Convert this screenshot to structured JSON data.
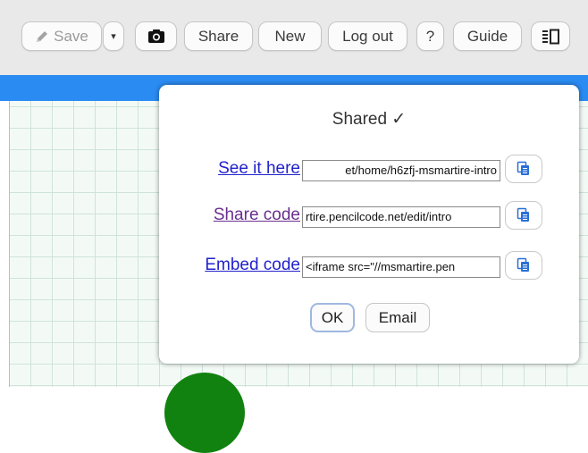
{
  "toolbar": {
    "save_label": "Save",
    "dropdown_glyph": "▾",
    "share_label": "Share",
    "new_label": "New",
    "logout_label": "Log out",
    "help_label": "?",
    "guide_label": "Guide"
  },
  "icons": {
    "save": "pencil-icon",
    "camera": "camera-icon",
    "layout": "layout-toggle-icon",
    "copy": "clipboard-copy-icon"
  },
  "colors": {
    "bluebar": "#2a8bf2",
    "link": "#2222cc",
    "link_visited": "#6a2e8f",
    "turtle": "#11820f"
  },
  "dialog": {
    "title": "Shared ✓",
    "rows": [
      {
        "label": "See it here",
        "value": "et/home/h6zfj-msmartire-intro"
      },
      {
        "label": "Share code",
        "value": "rtire.pencilcode.net/edit/intro"
      },
      {
        "label": "Embed code",
        "value": "<iframe src=\"//msmartire.pen"
      }
    ],
    "ok_label": "OK",
    "email_label": "Email"
  }
}
